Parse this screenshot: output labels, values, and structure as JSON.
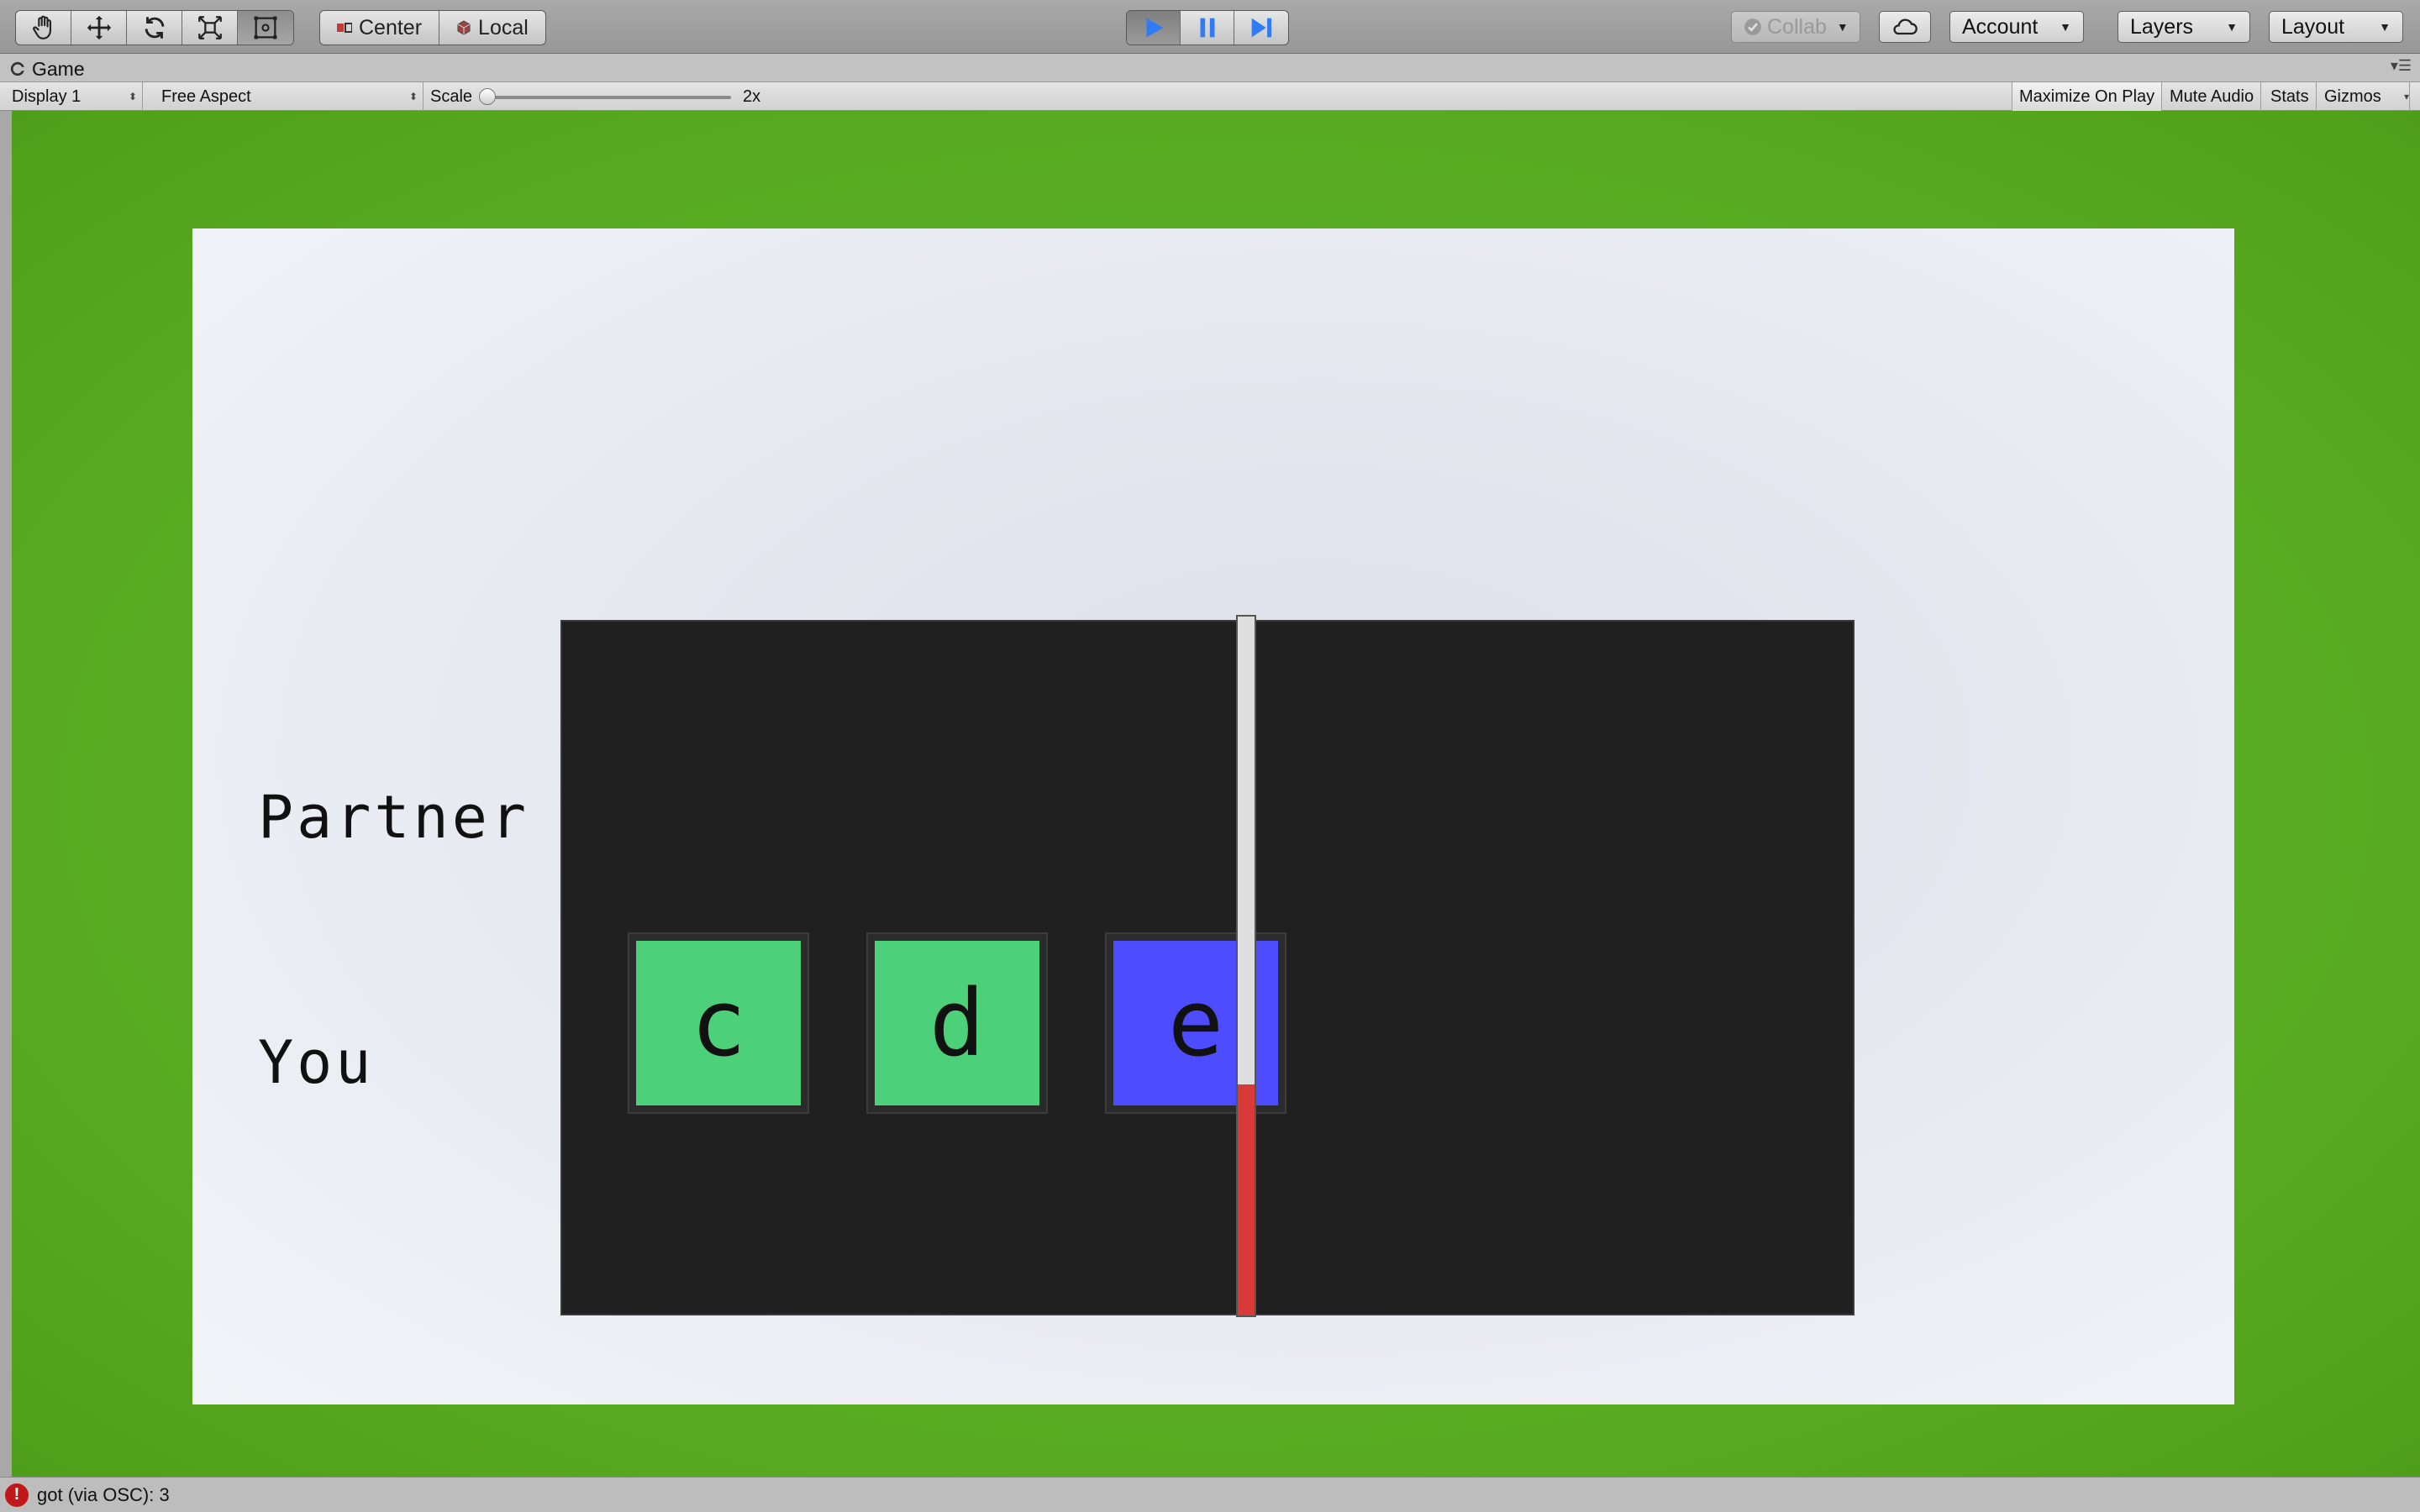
{
  "toolbar": {
    "transform_tools": [
      {
        "name": "hand-tool",
        "icon": "hand-icon"
      },
      {
        "name": "move-tool",
        "icon": "move-arrows-icon"
      },
      {
        "name": "rotate-tool",
        "icon": "rotate-icon"
      },
      {
        "name": "scale-tool",
        "icon": "scale-icon"
      },
      {
        "name": "rect-tool",
        "icon": "rect-transform-icon"
      }
    ],
    "pivot_center_label": "Center",
    "pivot_local_label": "Local",
    "play_controls": [
      "play-icon",
      "pause-icon",
      "step-icon"
    ],
    "collab_label": "Collab",
    "account_label": "Account",
    "layers_label": "Layers",
    "layout_label": "Layout",
    "accent_color": "#2f7cf6"
  },
  "tabs": {
    "game_label": "Game"
  },
  "gamebar": {
    "display_label": "Display 1",
    "aspect_label": "Free Aspect",
    "scale_label": "Scale",
    "scale_value": "2x",
    "maximize_label": "Maximize On Play",
    "mute_label": "Mute Audio",
    "stats_label": "Stats",
    "gizmos_label": "Gizmos"
  },
  "game": {
    "background_color": "#58ab20",
    "partner_label": "Partner",
    "you_label": "You",
    "letters": [
      {
        "letter": "c",
        "color": "#4cd17a"
      },
      {
        "letter": "d",
        "color": "#4cd17a"
      },
      {
        "letter": "e",
        "color": "#4d4dff"
      }
    ],
    "timeline_fill_fraction": 0.33,
    "timeline_fill_color": "#d83a3a"
  },
  "status": {
    "message": "got (via OSC): 3",
    "icon": "error-icon"
  }
}
